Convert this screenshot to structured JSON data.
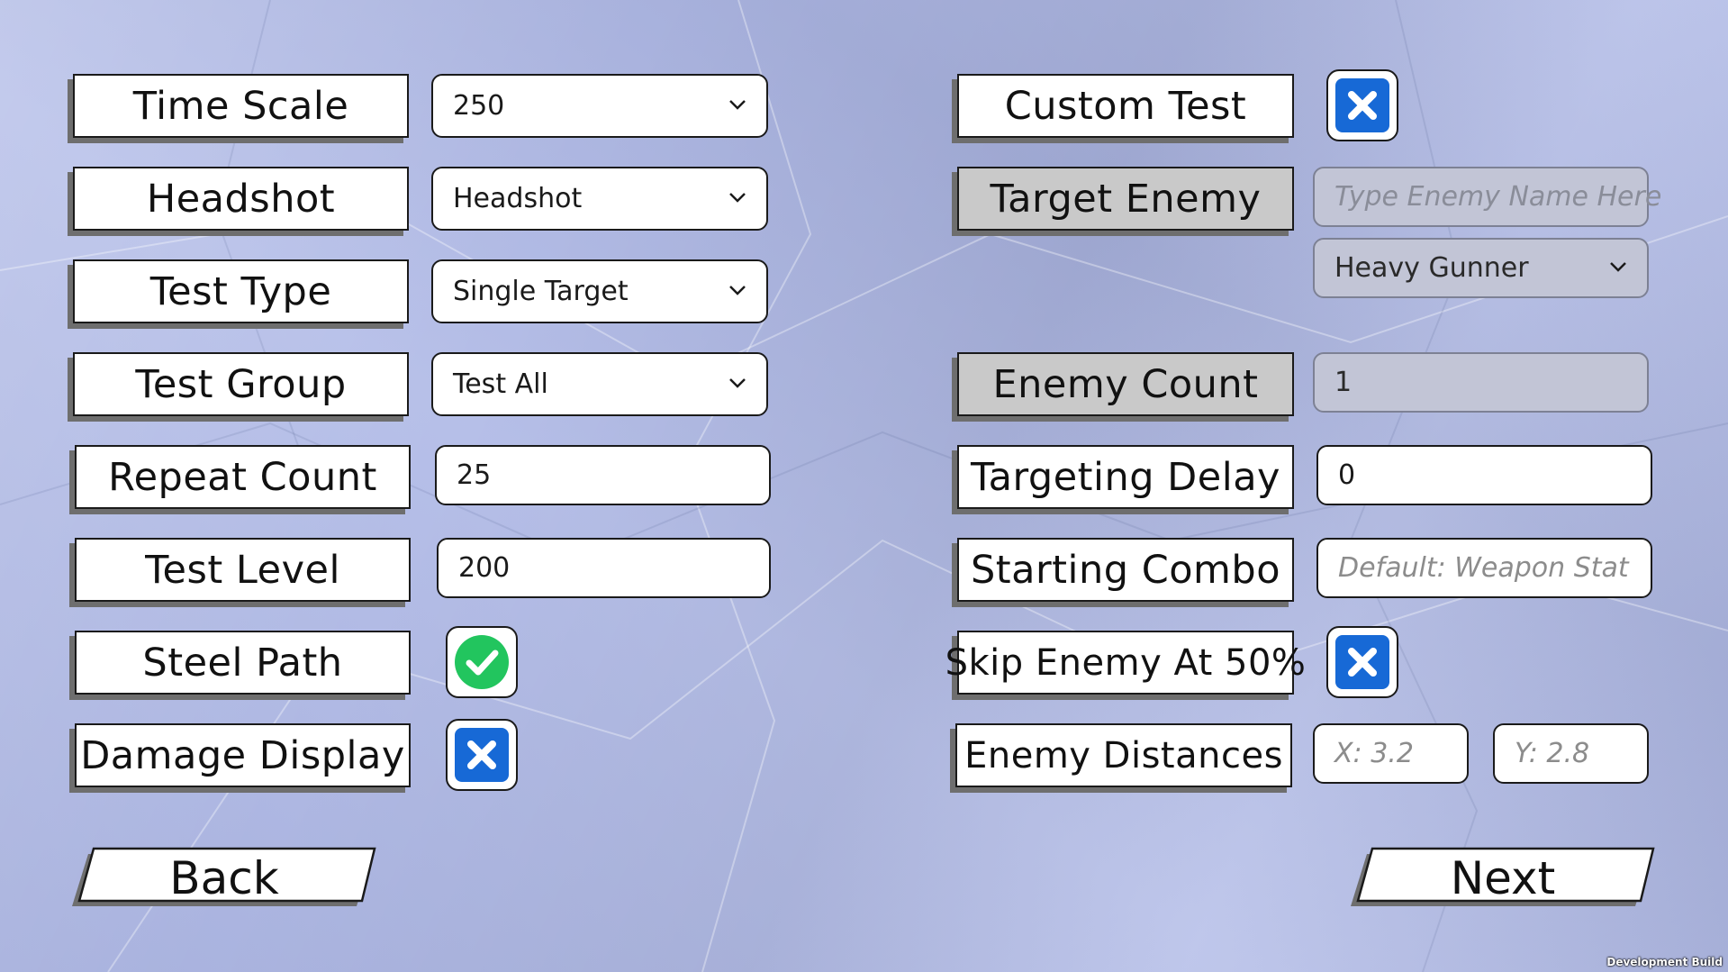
{
  "left_settings": [
    {
      "label": "Time Scale",
      "control": "dropdown",
      "value": "250"
    },
    {
      "label": "Headshot",
      "control": "dropdown",
      "value": "Headshot"
    },
    {
      "label": "Test Type",
      "control": "dropdown",
      "value": "Single Target"
    },
    {
      "label": "Test Group",
      "control": "dropdown",
      "value": "Test All"
    },
    {
      "label": "Repeat Count",
      "control": "input",
      "value": "25"
    },
    {
      "label": "Test Level",
      "control": "input",
      "value": "200"
    },
    {
      "label": "Steel Path",
      "control": "checkbox",
      "checked": true
    },
    {
      "label": "Damage Display",
      "control": "checkbox",
      "checked": false
    }
  ],
  "right_settings": {
    "custom_test": {
      "label": "Custom Test",
      "checked": false
    },
    "target_enemy": {
      "label": "Target Enemy",
      "placeholder": "Type Enemy Name Here",
      "dropdown_value": "Heavy Gunner",
      "disabled": true
    },
    "enemy_count": {
      "label": "Enemy Count",
      "value": "1",
      "disabled": true
    },
    "targeting_delay": {
      "label": "Targeting Delay",
      "value": "0"
    },
    "starting_combo": {
      "label": "Starting Combo",
      "placeholder": "Default: Weapon Stat"
    },
    "skip_enemy": {
      "label": "Skip Enemy At 50%",
      "checked": false
    },
    "enemy_distances": {
      "label": "Enemy Distances",
      "x_placeholder": "X: 3.2",
      "y_placeholder": "Y: 2.8"
    }
  },
  "nav": {
    "back_label": "Back",
    "next_label": "Next"
  },
  "footer": {
    "build_label": "Development Build"
  },
  "colors": {
    "background": "#aeb8e6",
    "check_on": "#22c55e",
    "check_off": "#1769d6",
    "disabled_label": "#c9c9c9"
  },
  "icons": {
    "dropdown": "chevron-down-icon",
    "checked": "checkmark-circle-icon",
    "unchecked": "x-square-icon"
  }
}
